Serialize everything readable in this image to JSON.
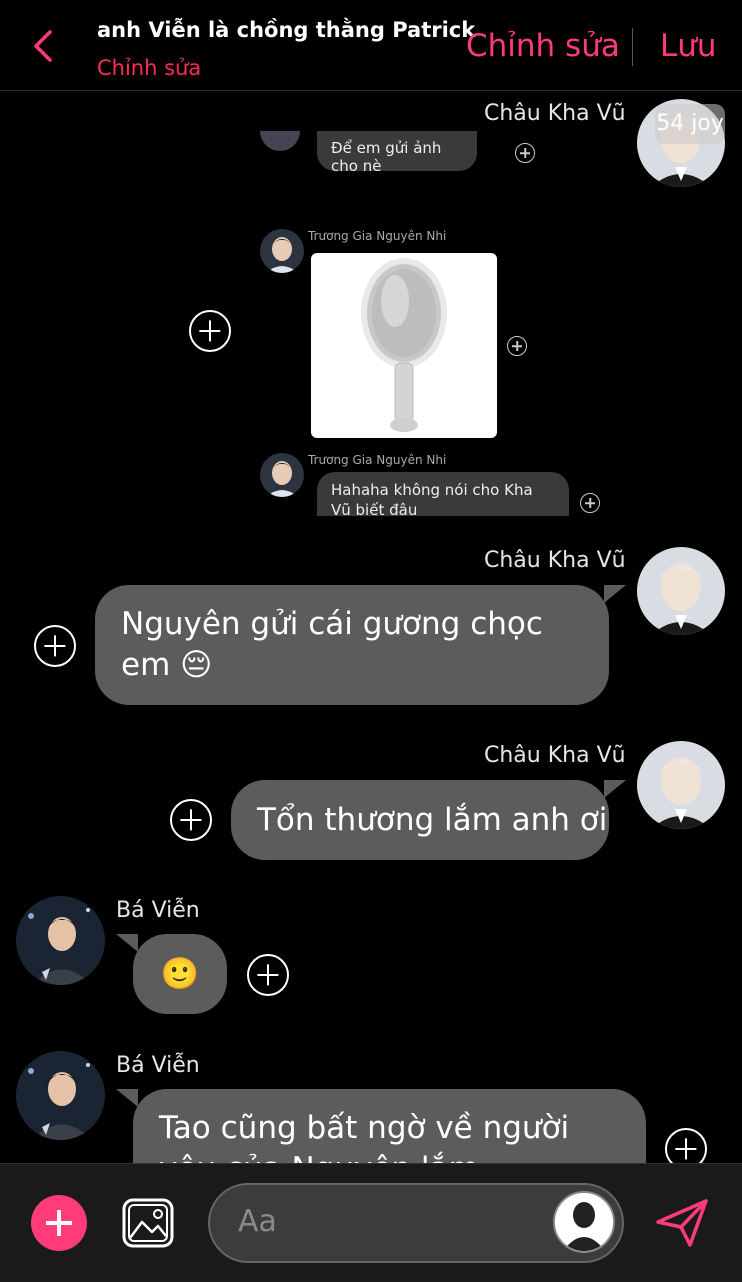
{
  "header": {
    "title": "anh Viễn là chồng thằng Patrick",
    "subtitle": "Chỉnh sửa",
    "edit_label": "Chỉnh sửa",
    "save_label": "Lưu"
  },
  "embedded_screenshot": {
    "top_message": "Để em gửi ảnh cho nè",
    "sender": "Trương Gia Nguyên Nhi",
    "sender2": "Trương Gia Nguyên Nhi",
    "message": "Hahaha không nói cho Kha Vũ biết đâu",
    "badge": "54 joy"
  },
  "messages": [
    {
      "sender": "Châu Kha Vũ",
      "side": "right",
      "text": ""
    },
    {
      "sender": "Châu Kha Vũ",
      "side": "right",
      "text": "Nguyên gửi cái gương chọc em 😔"
    },
    {
      "sender": "Châu Kha Vũ",
      "side": "right",
      "text": "Tổn thương lắm anh ơi"
    },
    {
      "sender": "Bá Viễn",
      "side": "left",
      "text": "🙂"
    },
    {
      "sender": "Bá Viễn",
      "side": "left",
      "text": "Tao cũng bất ngờ về người yêu của Nguyên lắm"
    }
  ],
  "composer": {
    "placeholder": "Aa"
  },
  "colors": {
    "accent": "#ff3b7a",
    "bubble": "#5c5c5c",
    "background": "#000000"
  },
  "icons": [
    "back-icon",
    "plus-icon",
    "image-icon",
    "send-icon",
    "avatar-icon"
  ]
}
